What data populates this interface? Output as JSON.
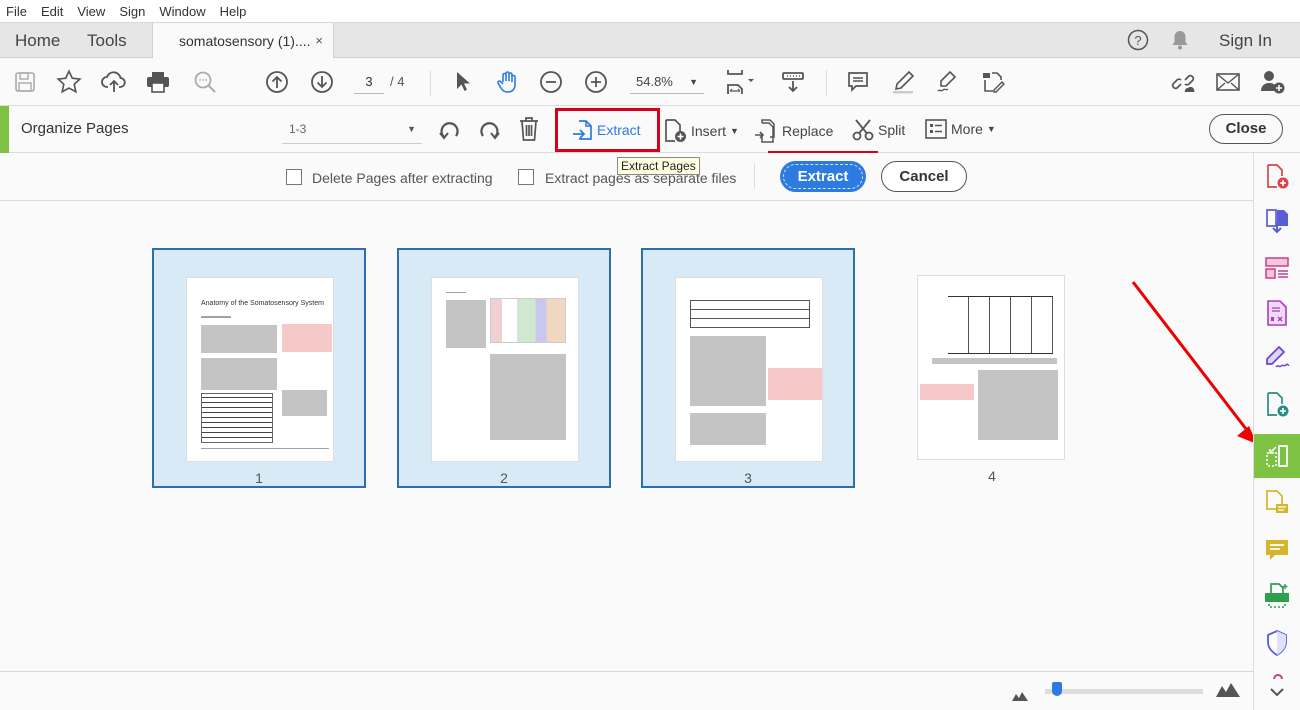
{
  "menu": [
    "File",
    "Edit",
    "View",
    "Sign",
    "Window",
    "Help"
  ],
  "tabs": {
    "home": "Home",
    "tools": "Tools",
    "document": "somatosensory (1)....",
    "close_glyph": "×",
    "sign_in": "Sign In"
  },
  "toolbar": {
    "current_page": "3",
    "total_pages": "/ 4",
    "zoom": "54.8%"
  },
  "organize": {
    "title": "Organize Pages",
    "range": "1-3",
    "extract": "Extract",
    "insert": "Insert",
    "replace": "Replace",
    "split": "Split",
    "more": "More",
    "close": "Close",
    "tooltip": "Extract Pages"
  },
  "extract_options": {
    "delete_after": "Delete Pages after extracting",
    "delete_after_checked": false,
    "separate_files": "Extract pages as separate files",
    "separate_files_checked": false,
    "extract_button": "Extract",
    "cancel_button": "Cancel"
  },
  "pages": [
    {
      "number": "1",
      "selected": true,
      "title": "Anatomy of the Somatosensory System"
    },
    {
      "number": "2",
      "selected": true
    },
    {
      "number": "3",
      "selected": true
    },
    {
      "number": "4",
      "selected": false
    }
  ],
  "thumbnail_zoom": 0.05,
  "colors": {
    "accent_green": "#7dc242",
    "primary_blue": "#2d7be0",
    "highlight_red": "#d9001b",
    "selection_blue": "#d9eaf7"
  }
}
